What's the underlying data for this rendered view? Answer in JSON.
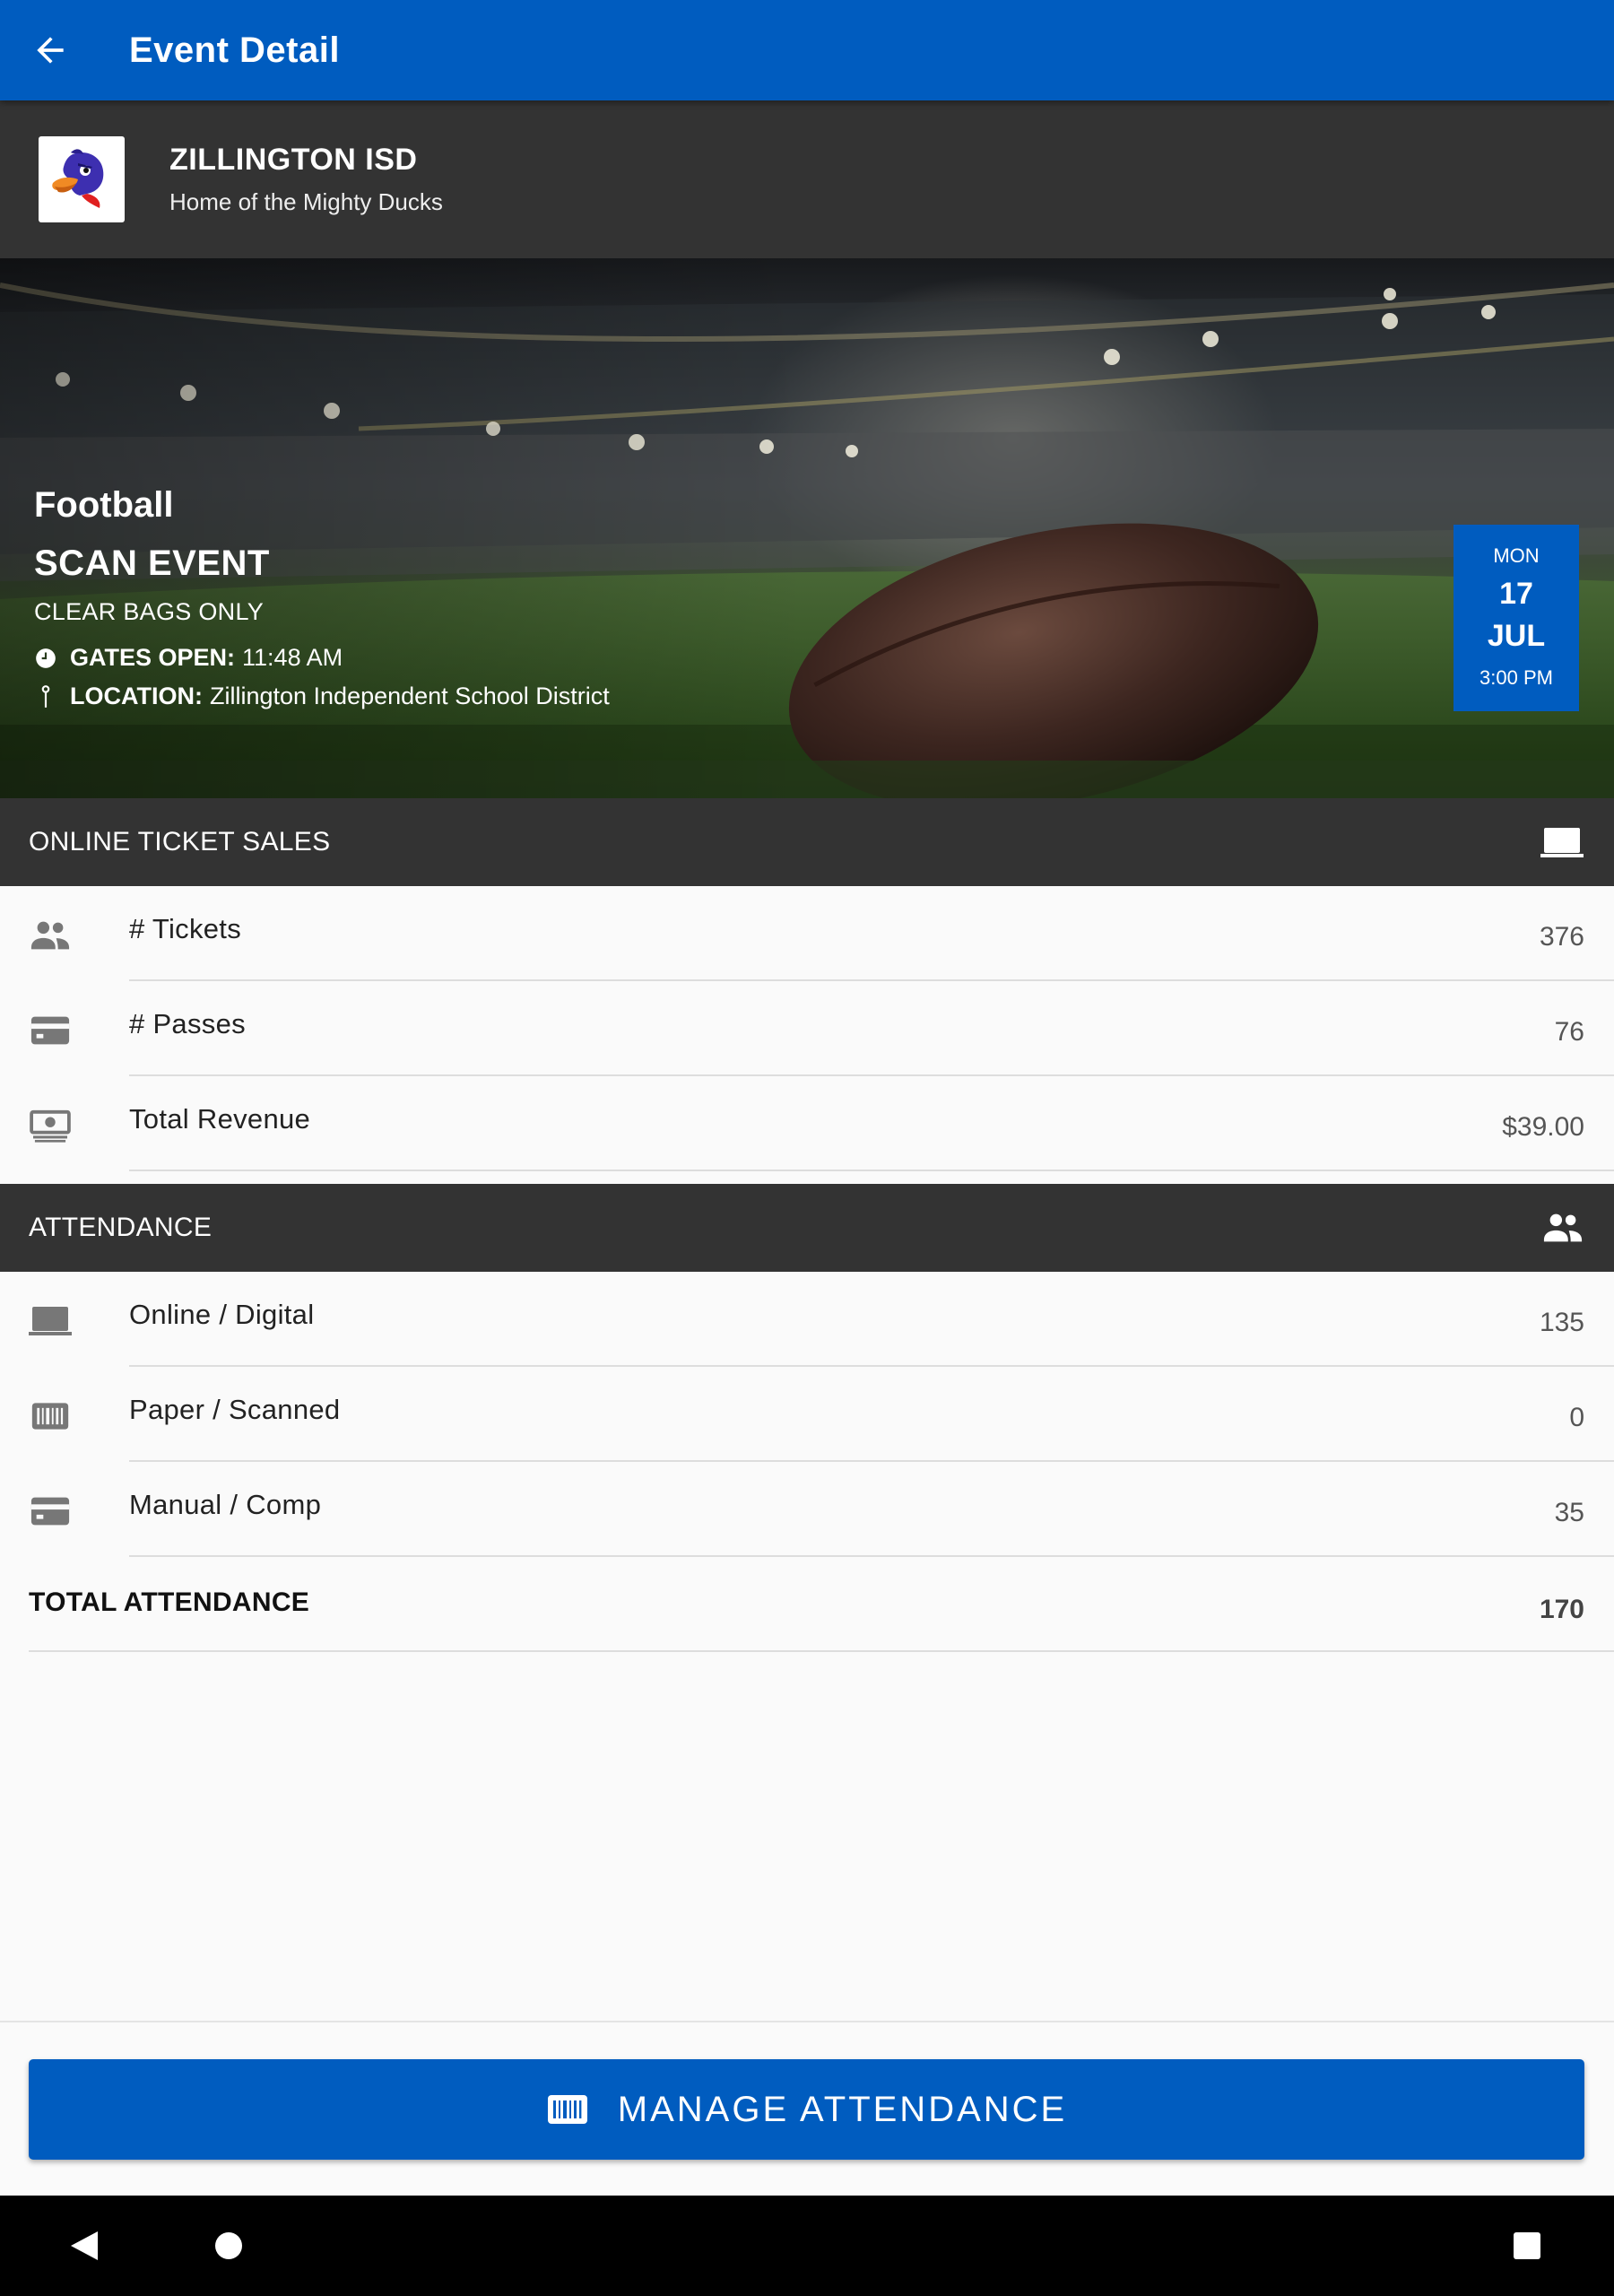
{
  "appbar": {
    "title": "Event Detail",
    "back_icon": "arrow-left-icon"
  },
  "org": {
    "name": "ZILLINGTON ISD",
    "tagline": "Home of the Mighty Ducks",
    "logo": "duck-mascot-logo"
  },
  "event": {
    "sport": "Football",
    "name": "SCAN EVENT",
    "note": "CLEAR BAGS ONLY",
    "gates_label": "GATES OPEN:",
    "gates_value": "11:48 AM",
    "location_label": "LOCATION:",
    "location_value": "Zillington Independent School District",
    "date": {
      "dow": "MON",
      "day": "17",
      "month": "JUL",
      "time": "3:00 PM"
    }
  },
  "online_sales": {
    "title": "ONLINE TICKET SALES",
    "icon": "laptop-icon",
    "rows": [
      {
        "label": "# Tickets",
        "value": "376",
        "icon": "people-icon"
      },
      {
        "label": "# Passes",
        "value": "76",
        "icon": "card-icon"
      },
      {
        "label": "Total Revenue",
        "value": "$39.00",
        "icon": "money-icon"
      }
    ]
  },
  "attendance": {
    "title": "ATTENDANCE",
    "icon": "people-icon",
    "rows": [
      {
        "label": "Online / Digital",
        "value": "135",
        "icon": "laptop-icon"
      },
      {
        "label": "Paper / Scanned",
        "value": "0",
        "icon": "barcode-icon"
      },
      {
        "label": "Manual / Comp",
        "value": "35",
        "icon": "card-icon"
      }
    ],
    "total_label": "TOTAL ATTENDANCE",
    "total_value": "170"
  },
  "manage_button": {
    "label": "MANAGE ATTENDANCE",
    "icon": "barcode-icon"
  },
  "colors": {
    "primary": "#005cbf",
    "section_bg": "#333333",
    "page_bg": "#fafafa"
  }
}
